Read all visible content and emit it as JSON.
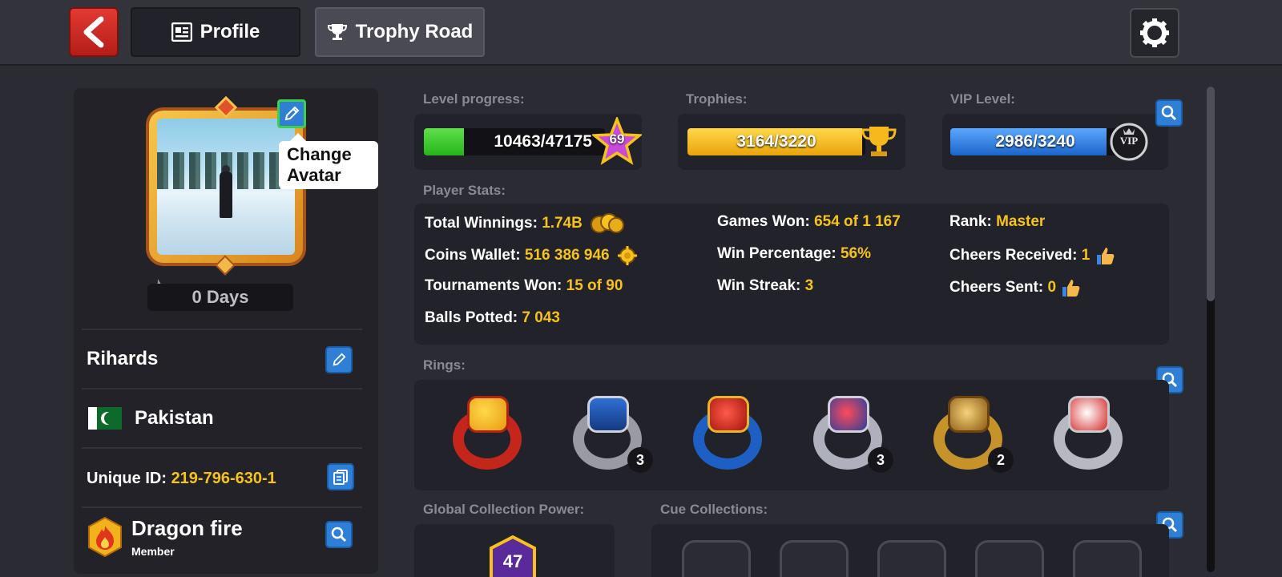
{
  "topbar": {
    "back_icon": "chevron-left-icon",
    "tabs": [
      {
        "label": "Profile",
        "icon": "profile-card-icon"
      },
      {
        "label": "Trophy Road",
        "icon": "trophy-icon"
      }
    ],
    "settings_icon": "gear-icon"
  },
  "player": {
    "tooltip": "Change Avatar",
    "streak": "0 Days",
    "name": "Rihards",
    "country": "Pakistan",
    "unique_id_label": "Unique ID:",
    "unique_id": "219-796-630-1",
    "club_name": "Dragon fire",
    "club_role": "Member"
  },
  "progress": {
    "level_label": "Level progress:",
    "level_value": "10463/47175",
    "level_fraction": 0.2218,
    "level_badge": "69",
    "trophies_label": "Trophies:",
    "trophies_value": "3164/3220",
    "trophies_fraction": 0.9826,
    "vip_label": "VIP Level:",
    "vip_value": "2986/3240",
    "vip_fraction": 0.9216,
    "vip_badge": "VIP"
  },
  "stats": {
    "label": "Player Stats:",
    "total_winnings_label": "Total Winnings:",
    "total_winnings": "1.74B",
    "coins_wallet_label": "Coins Wallet:",
    "coins_wallet": "516 386 946",
    "tournaments_won_label": "Tournaments Won:",
    "tournaments_won": "15 of 90",
    "balls_potted_label": "Balls Potted:",
    "balls_potted": "7 043",
    "games_won_label": "Games Won:",
    "games_won": "654 of 1 167",
    "win_percentage_label": "Win Percentage:",
    "win_percentage": "56%",
    "win_streak_label": "Win Streak:",
    "win_streak": "3",
    "rank_label": "Rank:",
    "rank": "Master",
    "cheers_received_label": "Cheers Received:",
    "cheers_received": "1",
    "cheers_sent_label": "Cheers Sent:",
    "cheers_sent": "0"
  },
  "rings": {
    "label": "Rings:",
    "counts": [
      "",
      "3",
      "",
      "3",
      "2",
      ""
    ]
  },
  "collections": {
    "gcp_label": "Global Collection Power:",
    "gcp_value": "47",
    "cue_label": "Cue Collections:"
  },
  "colors": {
    "level_fill": "#39d12a",
    "trophy_fill": "#f6c21c",
    "vip_fill": "#2f7fe0",
    "accent_yellow": "#f6c21c",
    "button_blue": "#2f7fd6"
  }
}
